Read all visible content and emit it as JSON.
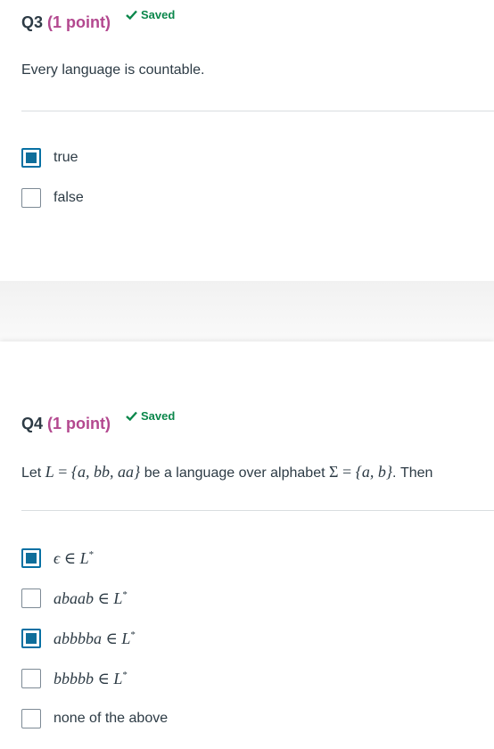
{
  "q3": {
    "number": "Q3",
    "points": "(1 point)",
    "saved": "Saved",
    "question": "Every language is countable.",
    "options": [
      {
        "label": "true",
        "checked": true
      },
      {
        "label": "false",
        "checked": false
      }
    ]
  },
  "q4": {
    "number": "Q4",
    "points": "(1 point)",
    "saved": "Saved",
    "question": {
      "p1": "Let ",
      "L": "L",
      "eq": " = ",
      "set1": "{a, bb, aa}",
      "p2": " be a language over alphabet ",
      "sigma": "Σ",
      "eq2": " = ",
      "set2": "{a, b}",
      "p3": ". Then"
    },
    "options": [
      {
        "label": "ϵ ∈ L*",
        "w": "ϵ",
        "checked": true
      },
      {
        "label": "abaab ∈ L*",
        "w": "abaab",
        "checked": false
      },
      {
        "label": "abbbba ∈ L*",
        "w": "abbbba",
        "checked": true
      },
      {
        "label": "bbbbb ∈ L*",
        "w": "bbbbb",
        "checked": false
      },
      {
        "label": "none of the above",
        "checked": false
      }
    ],
    "member": "∈",
    "lang": "L",
    "star": "*"
  },
  "colors": {
    "points": "#b3488f",
    "saved": "#0b874b",
    "checkbox_fill": "#0f6e9a",
    "text": "#2d3b45"
  },
  "icons": {
    "saved": "check-icon"
  }
}
